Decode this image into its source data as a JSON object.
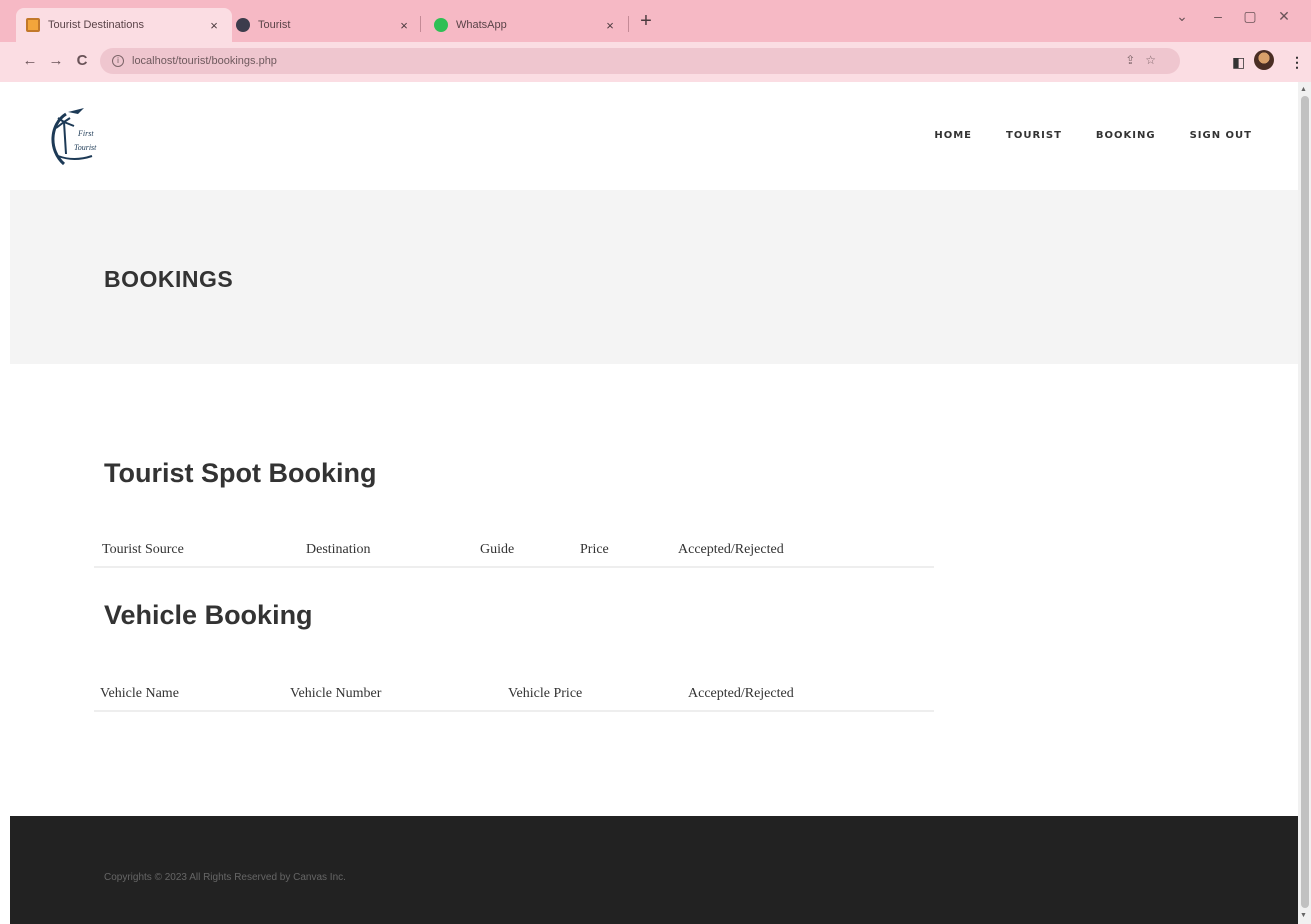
{
  "browser": {
    "tabs": [
      {
        "title": "Tourist Destinations",
        "icon": "document-favicon-icon",
        "active": true
      },
      {
        "title": "Tourist",
        "icon": "tourist-favicon-icon",
        "active": false
      },
      {
        "title": "WhatsApp",
        "icon": "whatsapp-favicon-icon",
        "active": false
      }
    ],
    "tab_close": "×",
    "new_tab": "+",
    "window_controls": {
      "menu": "⌄",
      "minimize": "–",
      "maximize": "▢",
      "close": "✕"
    },
    "nav": {
      "back": "←",
      "forward": "→",
      "reload": "C"
    },
    "url": "localhost/tourist/bookings.php",
    "colors": {
      "tabstrip": "#f6b9c5",
      "toolbar": "#fbdde3"
    }
  },
  "site": {
    "nav": [
      "HOME",
      "TOURIST",
      "BOOKING",
      "SIGN OUT"
    ],
    "banner_title": "BOOKINGS",
    "tourist_section": {
      "title": "Tourist Spot Booking",
      "columns": [
        "Tourist Source",
        "Destination",
        "Guide",
        "Price",
        "Accepted/Rejected"
      ]
    },
    "vehicle_section": {
      "title": "Vehicle Booking",
      "columns": [
        "Vehicle Name",
        "Vehicle Number",
        "Vehicle Price",
        "Accepted/Rejected"
      ]
    },
    "footer_text": "Copyrights © 2023 All Rights Reserved by Canvas Inc.",
    "colors": {
      "banner": "#f4f4f4",
      "footer": "#222222",
      "text": "#333333"
    }
  }
}
